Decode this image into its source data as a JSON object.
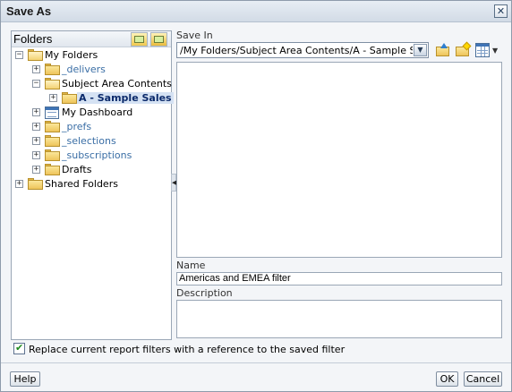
{
  "dialog": {
    "title": "Save As",
    "close_icon": "close-icon"
  },
  "folders_pane": {
    "header_label": "Folders",
    "header_icons": [
      "folder-tree-view-icon",
      "new-folder-icon"
    ],
    "tree": [
      {
        "label": "My Folders",
        "toggle": "−",
        "icon": "folder-open-icon"
      },
      {
        "label": "_delivers",
        "toggle": "+",
        "icon": "folder-icon"
      },
      {
        "label": "Subject Area Contents",
        "toggle": "−",
        "icon": "folder-open-icon"
      },
      {
        "label": "A - Sample Sales",
        "toggle": "+",
        "icon": "folder-icon",
        "selected": true
      },
      {
        "label": "My Dashboard",
        "toggle": "+",
        "icon": "dashboard-icon"
      },
      {
        "label": "_prefs",
        "toggle": "+",
        "icon": "folder-icon"
      },
      {
        "label": "_selections",
        "toggle": "+",
        "icon": "folder-icon"
      },
      {
        "label": "_subscriptions",
        "toggle": "+",
        "icon": "folder-icon"
      },
      {
        "label": "Drafts",
        "toggle": "+",
        "icon": "folder-icon"
      },
      {
        "label": "Shared Folders",
        "toggle": "+",
        "icon": "folder-icon"
      }
    ]
  },
  "save_in": {
    "label": "Save In",
    "path": "/My Folders/Subject Area Contents/A - Sample Sales",
    "tool_icons": [
      "folder-up-icon",
      "new-folder-icon",
      "view-grid-icon"
    ]
  },
  "name_field": {
    "label": "Name",
    "value": "Americas and EMEA filter"
  },
  "description_field": {
    "label": "Description",
    "value": ""
  },
  "replace_filters": {
    "label": "Replace current report filters with a reference to the saved filter",
    "checked": true
  },
  "buttons": {
    "help": "Help",
    "ok": "OK",
    "cancel": "Cancel"
  },
  "colors": {
    "link": "#3a6ea5",
    "selection_bg": "#d5e2f3",
    "dialog_bg": "#f3f5f8"
  }
}
